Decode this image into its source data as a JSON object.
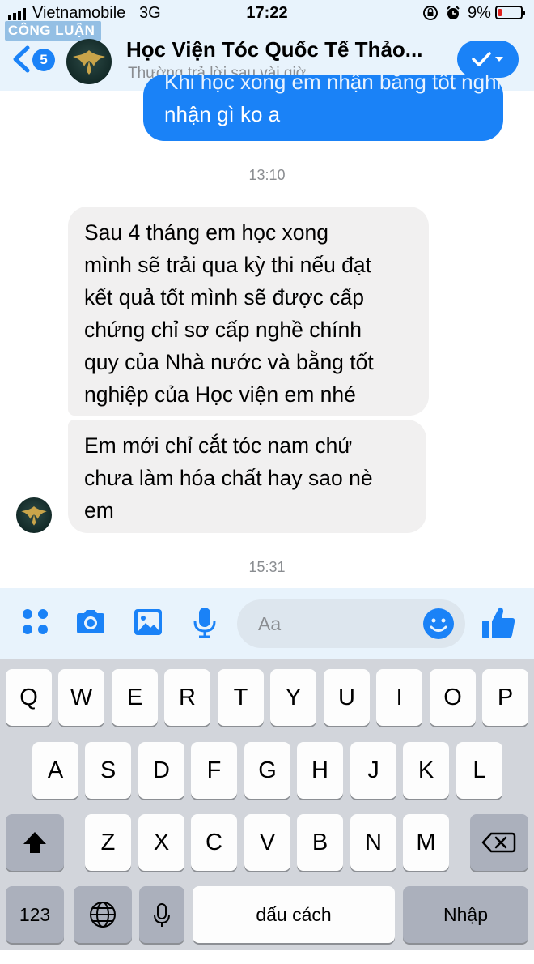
{
  "status_bar": {
    "carrier": "Vietnamobile",
    "network": "3G",
    "time": "17:22",
    "battery": "9%",
    "battery_color": "#e0211d"
  },
  "watermark": "CÔNG LUẬN",
  "header": {
    "back_badge": "5",
    "title": "Học Viện Tóc Quốc Tế Thảo...",
    "subtitle": "Thường trả lời sau vài giờ",
    "accent": "#1a82f7",
    "action_icon": "check-chevron-icon"
  },
  "messages": {
    "outgoing_partial": "Khi học xong em nhận bằng tốt nghiệp chứng",
    "outgoing_visible": "nhận gì ko a",
    "timestamp1": "13:10",
    "incoming1": [
      "Sau 4 tháng em học xong",
      "mình sẽ trải qua kỳ thi nếu đạt",
      "kết quả tốt mình sẽ được cấp",
      "chứng chỉ sơ cấp nghề chính",
      "quy của Nhà nước và bằng tốt",
      "nghiệp của Học viện em nhé"
    ],
    "incoming2": [
      "Em mới chỉ cắt tóc nam chứ",
      "chưa làm hóa chất hay sao nè",
      "em"
    ],
    "timestamp2": "15:31"
  },
  "composer": {
    "placeholder": "Aa",
    "icons": [
      "menu-dots-icon",
      "camera-icon",
      "photo-icon",
      "microphone-icon",
      "emoji-icon",
      "thumbs-up-icon"
    ]
  },
  "keyboard": {
    "row1": [
      "Q",
      "W",
      "E",
      "R",
      "T",
      "Y",
      "U",
      "I",
      "O",
      "P"
    ],
    "row2": [
      "A",
      "S",
      "D",
      "F",
      "G",
      "H",
      "J",
      "K",
      "L"
    ],
    "row3": [
      "Z",
      "X",
      "C",
      "V",
      "B",
      "N",
      "M"
    ],
    "numbers": "123",
    "space": "dấu cách",
    "return": "Nhập"
  }
}
